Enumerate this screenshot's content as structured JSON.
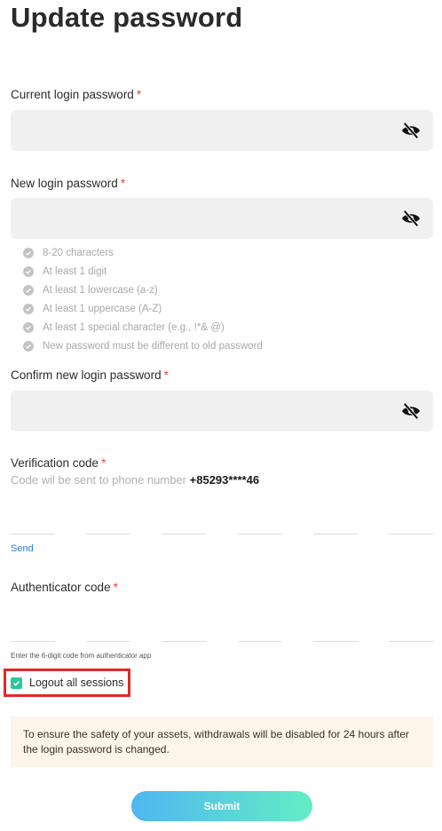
{
  "page": {
    "title": "Update password"
  },
  "current_password": {
    "label": "Current login password",
    "required": "*",
    "value": "",
    "icon": "eye-off-icon"
  },
  "new_password": {
    "label": "New login password",
    "required": "*",
    "value": "",
    "icon": "eye-off-icon",
    "rules": [
      "8-20 characters",
      "At least 1 digit",
      "At least 1 lowercase (a-z)",
      "At least 1 uppercase (A-Z)",
      "At least 1 special character (e.g., !*& @)",
      "New password must be different to old password"
    ]
  },
  "confirm_password": {
    "label": "Confirm new login password",
    "required": "*",
    "value": "",
    "icon": "eye-off-icon"
  },
  "verification": {
    "label": "Verification code",
    "required": "*",
    "sub_text": "Code wil be sent to phone number ",
    "phone": "+85293****46",
    "send_label": "Send",
    "digits": [
      "",
      "",
      "",
      "",
      "",
      ""
    ]
  },
  "authenticator": {
    "label": "Authenticator code",
    "required": "*",
    "hint": "Enter the 6-digit code from authenticator app",
    "digits": [
      "",
      "",
      "",
      "",
      "",
      ""
    ]
  },
  "logout": {
    "label": "Logout all sessions",
    "checked": true
  },
  "notice": {
    "text": "To ensure the safety of your assets, withdrawals will be disabled for 24 hours after the login password is changed."
  },
  "submit": {
    "label": "Submit"
  },
  "colors": {
    "accent_green": "#2cc79a",
    "link_blue": "#2f7de1",
    "required_red": "#e0463f",
    "highlight_red": "#e02828",
    "notice_bg": "#fdf4ea"
  }
}
